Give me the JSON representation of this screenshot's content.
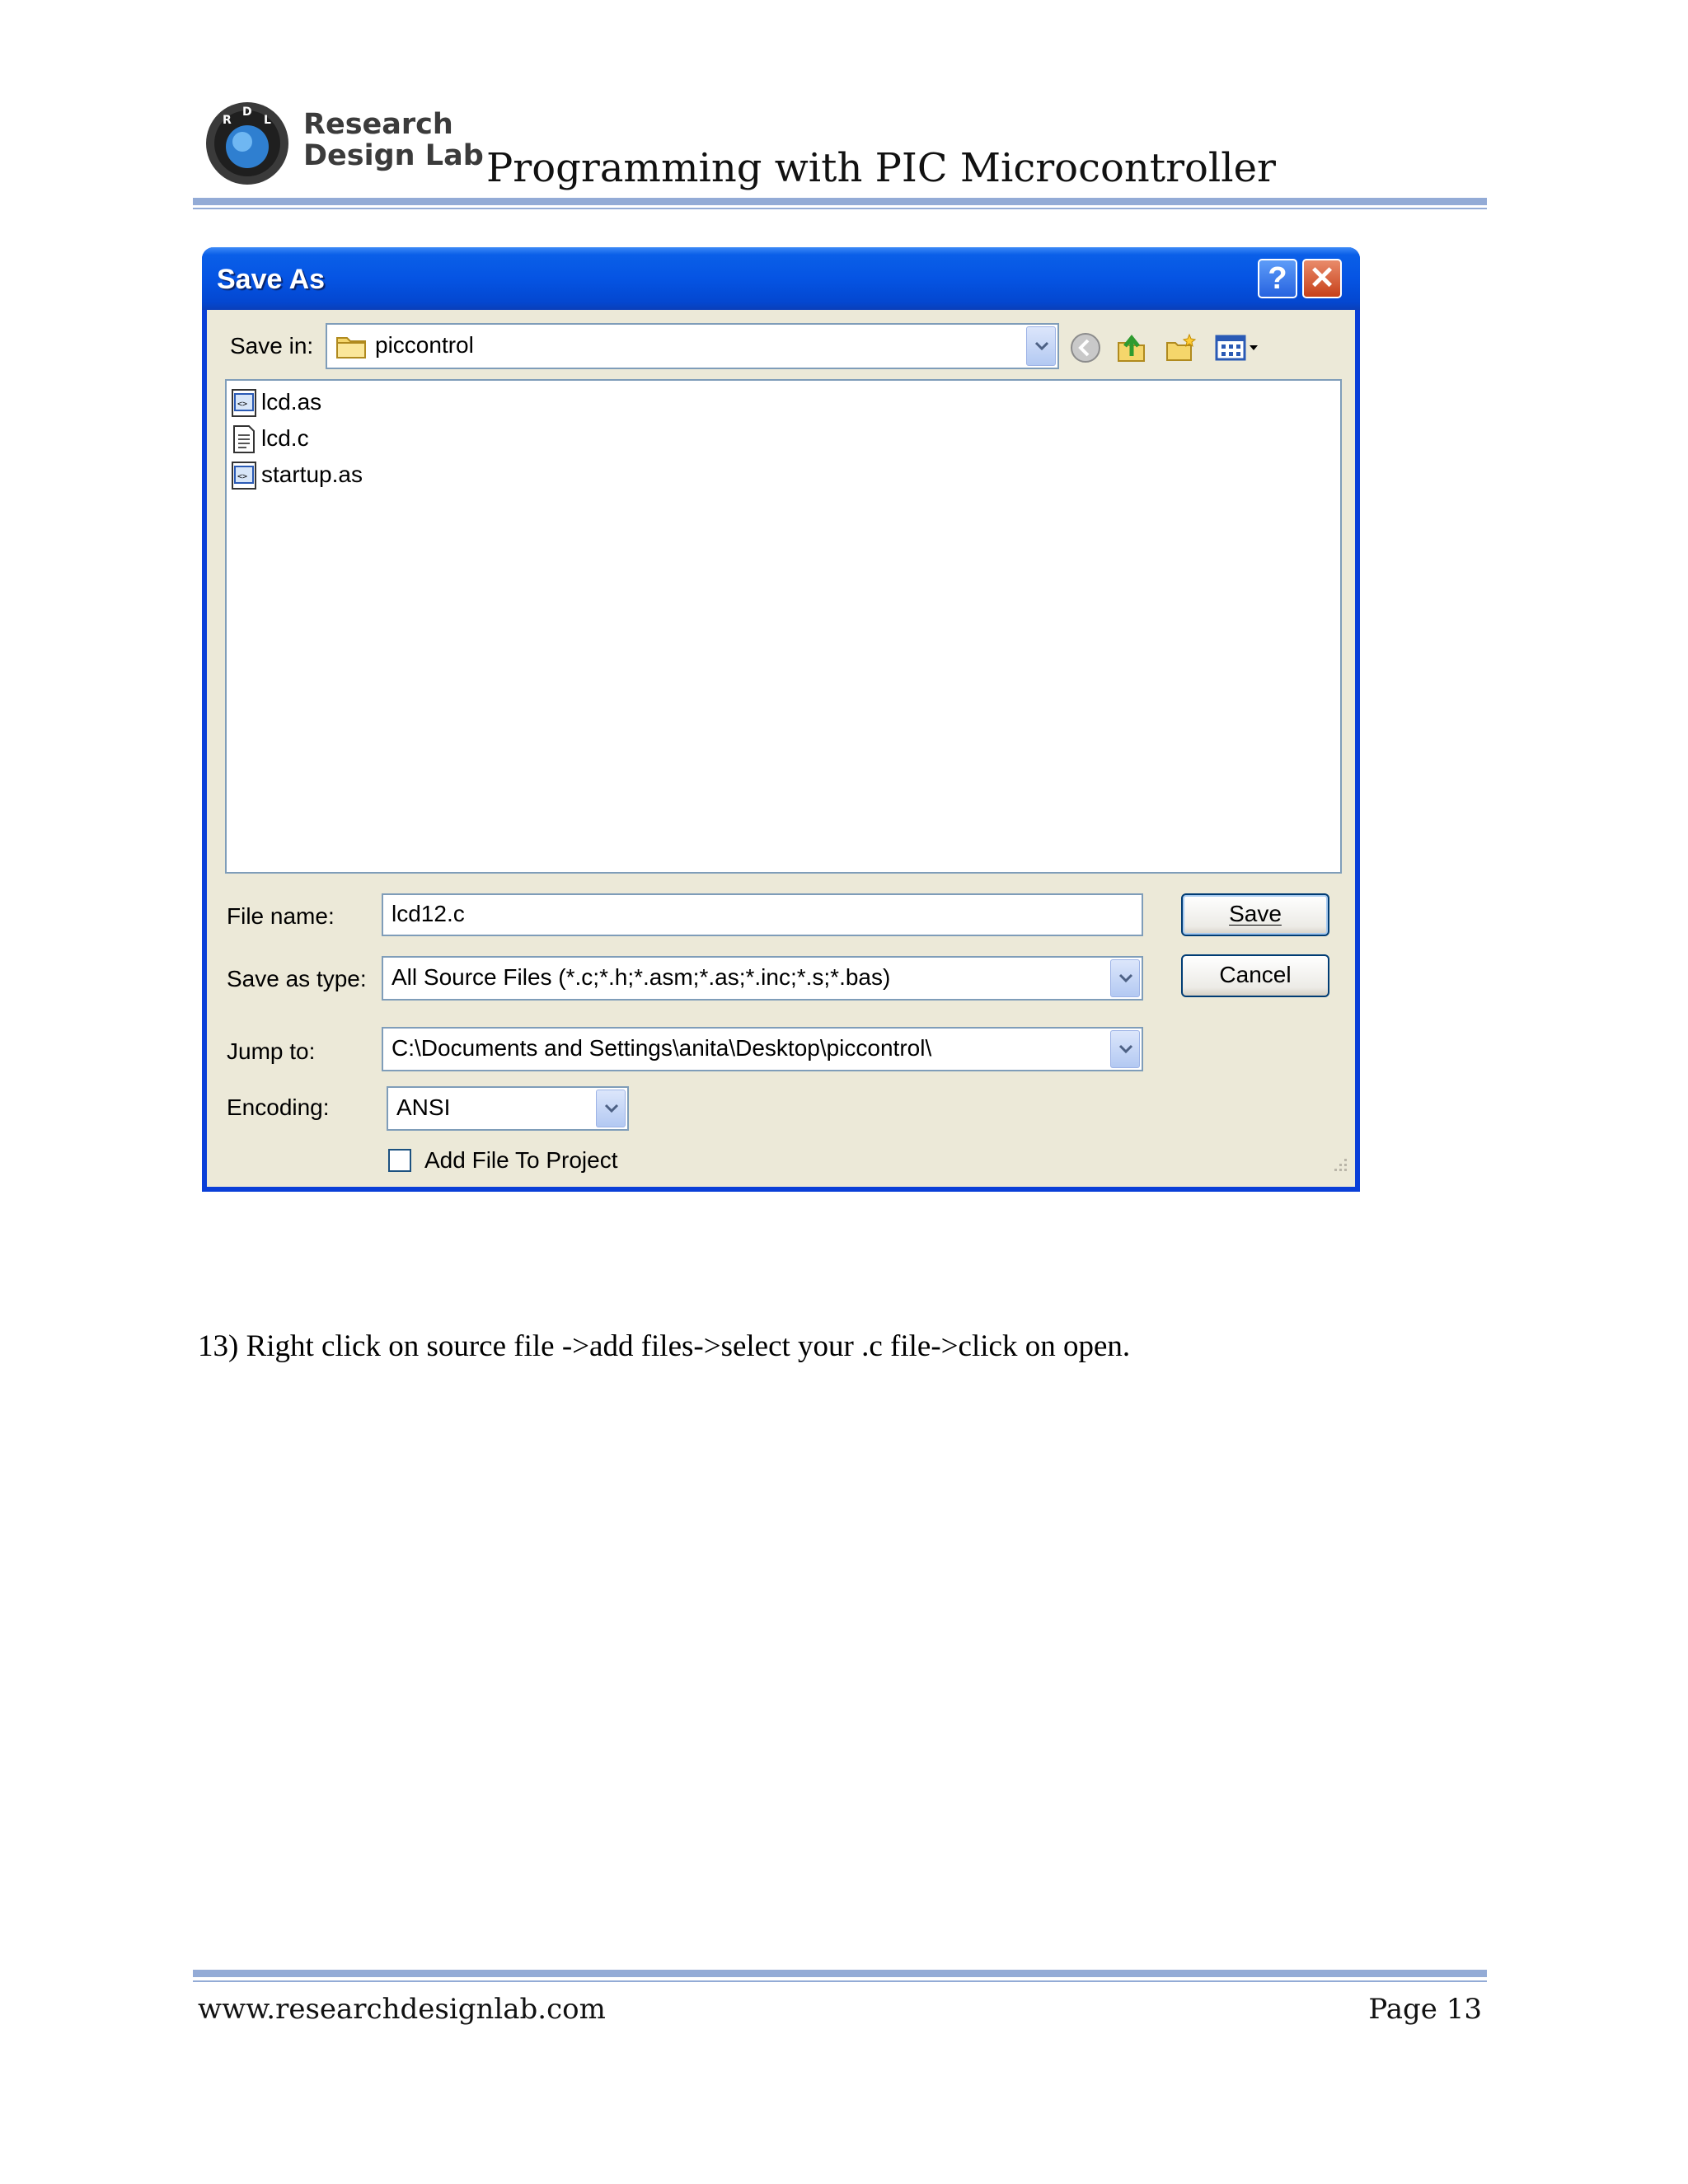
{
  "header": {
    "logo_letters": "RDL",
    "logo_line1": "Research",
    "logo_line2": "Design Lab",
    "title": "Programming with PIC Microcontroller"
  },
  "dialog": {
    "title": "Save As",
    "save_in_label": "Save in:",
    "save_in_value": "piccontrol",
    "files": [
      {
        "name": "lcd.as",
        "icon": "asm-file-icon"
      },
      {
        "name": "lcd.c",
        "icon": "text-file-icon"
      },
      {
        "name": "startup.as",
        "icon": "asm-file-icon"
      }
    ],
    "file_name_label": "File name:",
    "file_name_value": "lcd12.c",
    "save_type_label": "Save as type:",
    "save_type_value": "All Source Files (*.c;*.h;*.asm;*.as;*.inc;*.s;*.bas)",
    "jump_to_label": "Jump to:",
    "jump_to_value": "C:\\Documents and Settings\\anita\\Desktop\\piccontrol\\",
    "encoding_label": "Encoding:",
    "encoding_value": "ANSI",
    "add_file_label": "Add File To Project",
    "save_button": "Save",
    "cancel_button": "Cancel",
    "help_glyph": "?",
    "close_glyph": "✕"
  },
  "body": {
    "step": "13) Right click on source file ->add files->select your .c file->click on open."
  },
  "footer": {
    "website": "www.researchdesignlab.com",
    "page": "Page 13"
  },
  "colors": {
    "titlebar": "#0554e3",
    "dialog_bg": "#ece9d8",
    "rule": "#93abd6"
  }
}
